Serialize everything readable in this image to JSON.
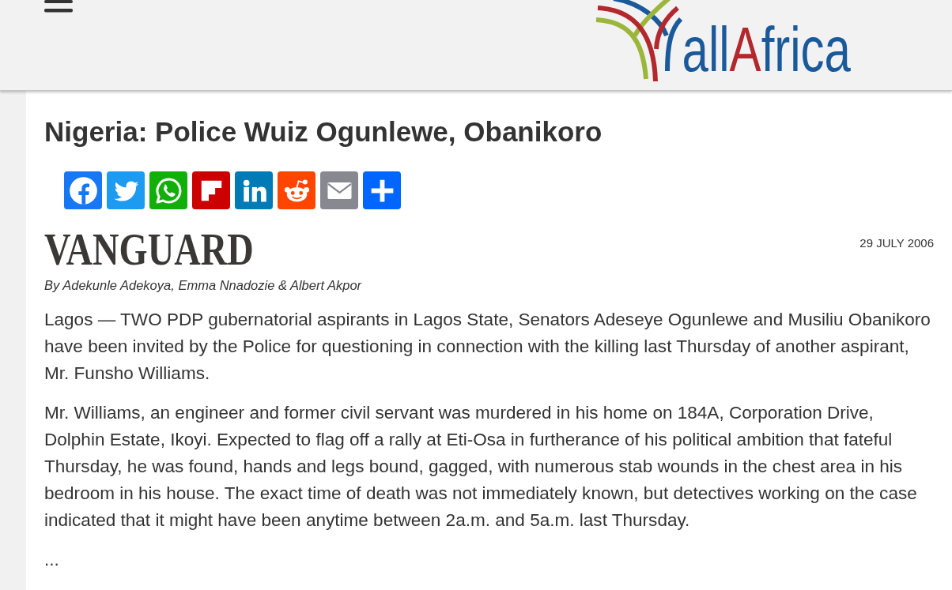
{
  "header": {
    "logo": [
      {
        "text": "all",
        "color": "#1b5a9a"
      },
      {
        "text": "A",
        "color": "#b3282d"
      },
      {
        "text": "frica",
        "color": "#1b5a9a"
      }
    ]
  },
  "article": {
    "title": "Nigeria: Police Wuiz Ogunlewe, Obanikoro",
    "share_buttons": [
      {
        "kind": "facebook",
        "color": "#1877f2"
      },
      {
        "kind": "twitter",
        "color": "#1d9bf0"
      },
      {
        "kind": "whatsapp",
        "color": "#12af0a"
      },
      {
        "kind": "flipboard",
        "color": "#cc0000"
      },
      {
        "kind": "linkedin",
        "color": "#007bb5"
      },
      {
        "kind": "reddit",
        "color": "#ff4500"
      },
      {
        "kind": "email",
        "color": "#888990"
      },
      {
        "kind": "share",
        "color": "#0166ff"
      }
    ],
    "source": "VANGUARD",
    "date": "29 JULY 2006",
    "byline": "By Adekunle Adekoya, Emma Nnadozie & Albert Akpor",
    "paragraphs": [
      "Lagos — TWO PDP gubernatorial aspirants in Lagos State, Senators Adeseye Ogunlewe and Musiliu Obanikoro have been invited by the Police for questioning in connection with the killing last Thursday of another aspirant, Mr. Funsho Williams.",
      "Mr. Williams, an engineer and former civil servant was murdered in his home on 184A, Corporation Drive, Dolphin Estate, Ikoyi. Expected to flag off a rally at Eti-Osa in furtherance of his political ambition that fateful Thursday, he was found, hands and legs bound, gagged, with numerous stab wounds in the chest area in his bedroom in his house. The exact time of death was not immediately known, but detectives working on the case indicated that it might have been anytime between 2a.m. and 5a.m. last Thursday.",
      "..."
    ]
  }
}
